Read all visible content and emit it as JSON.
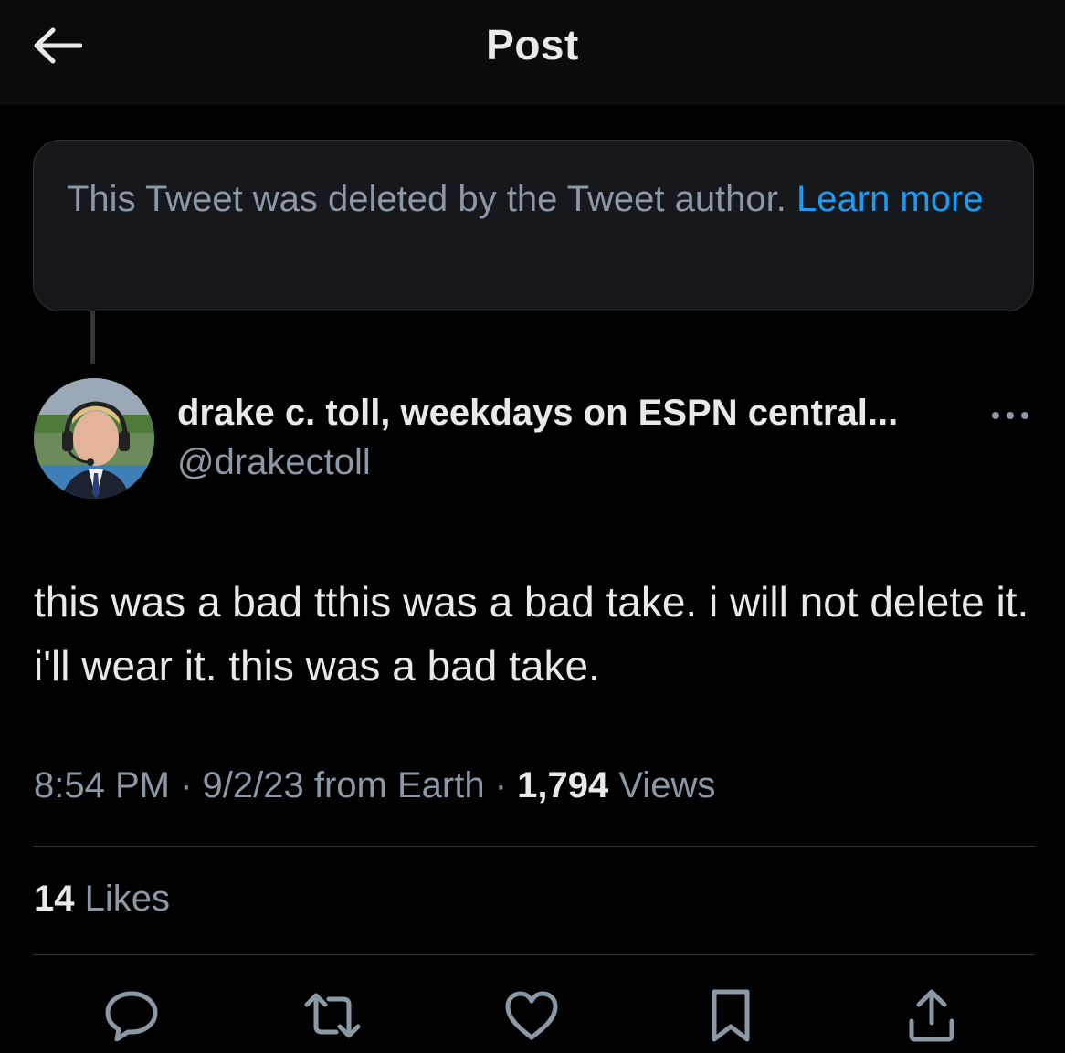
{
  "header": {
    "title": "Post"
  },
  "deleted_notice": {
    "text": "This Tweet was deleted by the Tweet author. ",
    "link_label": "Learn more"
  },
  "author": {
    "name": "drake c. toll, weekdays on ESPN central...",
    "handle": "@drakectoll"
  },
  "tweet": {
    "text": "this was a bad tthis was a bad take. i will not delete it. i'll wear it. this was a bad take."
  },
  "meta": {
    "time": "8:54 PM",
    "separator": " · ",
    "date": "9/2/23",
    "source": " from Earth",
    "views_count": "1,794",
    "views_label": " Views"
  },
  "stats": {
    "likes_count": "14",
    "likes_label": " Likes"
  },
  "actions": {
    "icons": [
      "reply-icon",
      "repost-icon",
      "like-icon",
      "bookmark-icon",
      "share-icon"
    ]
  },
  "colors": {
    "background": "#000000",
    "header": "#0b0b0b",
    "text_primary": "#e7e9ea",
    "text_secondary": "#8b98a5",
    "link": "#1d9bf0",
    "divider": "#2f3336",
    "notice_bg": "#16181c"
  }
}
